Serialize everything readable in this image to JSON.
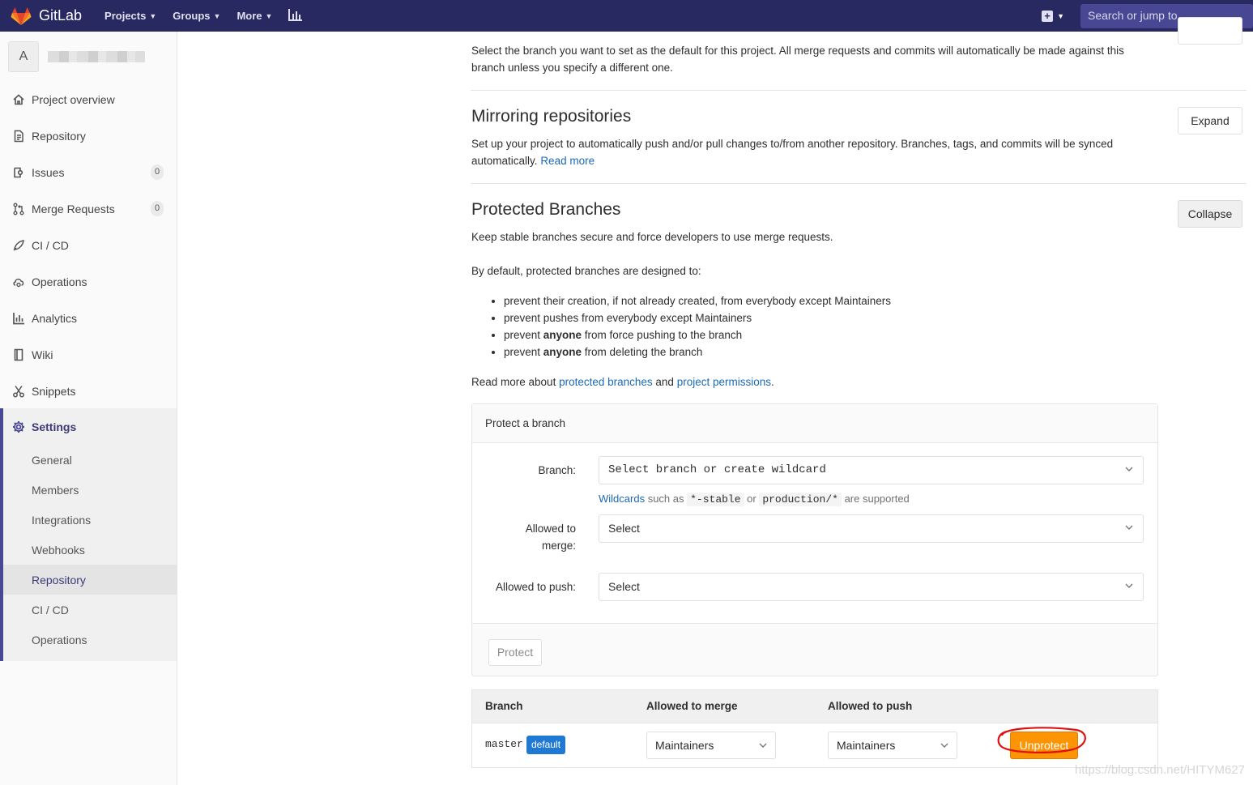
{
  "navbar": {
    "brand": "GitLab",
    "items": [
      {
        "label": "Projects",
        "icon": "chevron-down-icon"
      },
      {
        "label": "Groups",
        "icon": "chevron-down-icon"
      },
      {
        "label": "More",
        "icon": "chevron-down-icon"
      }
    ],
    "chart_icon": "bar-chart-icon",
    "new_icon": "plus-square-icon",
    "search_placeholder": "Search or jump to..."
  },
  "sidebar": {
    "avatar_letter": "A",
    "items": [
      {
        "label": "Project overview",
        "icon": "home-icon"
      },
      {
        "label": "Repository",
        "icon": "file-icon"
      },
      {
        "label": "Issues",
        "icon": "issues-icon",
        "count": "0"
      },
      {
        "label": "Merge Requests",
        "icon": "merge-request-icon",
        "count": "0"
      },
      {
        "label": "CI / CD",
        "icon": "rocket-icon"
      },
      {
        "label": "Operations",
        "icon": "cloud-gear-icon"
      },
      {
        "label": "Analytics",
        "icon": "chart-icon"
      },
      {
        "label": "Wiki",
        "icon": "book-icon"
      },
      {
        "label": "Snippets",
        "icon": "scissors-icon"
      }
    ],
    "settings": {
      "label": "Settings",
      "icon": "gear-icon",
      "subitems": [
        "General",
        "Members",
        "Integrations",
        "Webhooks",
        "Repository",
        "CI / CD",
        "Operations"
      ],
      "active": "Repository"
    }
  },
  "main": {
    "default_branch_text": "Select the branch you want to set as the default for this project. All merge requests and commits will automatically be made against this branch unless you specify a different one.",
    "mirroring": {
      "title": "Mirroring repositories",
      "desc": "Set up your project to automatically push and/or pull changes to/from another repository. Branches, tags, and commits will be synced automatically.",
      "read_more": "Read more",
      "button": "Expand"
    },
    "protected": {
      "title": "Protected Branches",
      "button": "Collapse",
      "desc": "Keep stable branches secure and force developers to use merge requests.",
      "intro": "By default, protected branches are designed to:",
      "bullets": [
        {
          "pre": "prevent their creation, if not already created, from everybody except Maintainers",
          "bold": "",
          "post": ""
        },
        {
          "pre": "prevent pushes from everybody except Maintainers",
          "bold": "",
          "post": ""
        },
        {
          "pre": "prevent ",
          "bold": "anyone",
          "post": " from force pushing to the branch"
        },
        {
          "pre": "prevent ",
          "bold": "anyone",
          "post": " from deleting the branch"
        }
      ],
      "read_more_pre": "Read more about ",
      "link1": "protected branches",
      "and": " and ",
      "link2": "project permissions",
      "period": "."
    },
    "protect_form": {
      "header": "Protect a branch",
      "branch_label": "Branch:",
      "branch_placeholder": "Select branch or create wildcard",
      "hint_link": "Wildcards",
      "hint_such": " such as ",
      "hint_code1": "*-stable",
      "hint_or": " or ",
      "hint_code2": "production/*",
      "hint_end": " are supported",
      "merge_label": "Allowed to merge:",
      "merge_value": "Select",
      "push_label": "Allowed to push:",
      "push_value": "Select",
      "submit": "Protect"
    },
    "table": {
      "headers": [
        "Branch",
        "Allowed to merge",
        "Allowed to push"
      ],
      "rows": [
        {
          "branch": "master",
          "badge": "default",
          "merge": "Maintainers",
          "push": "Maintainers",
          "action": "Unprotect"
        }
      ]
    }
  },
  "watermark": "https://blog.csdn.net/HITYM627",
  "colors": {
    "navbar": "#292961",
    "accent": "#474794",
    "link": "#1b69b6",
    "badge": "#1f78d1",
    "unprotect": "#fc9403",
    "annotation": "#e01010"
  }
}
